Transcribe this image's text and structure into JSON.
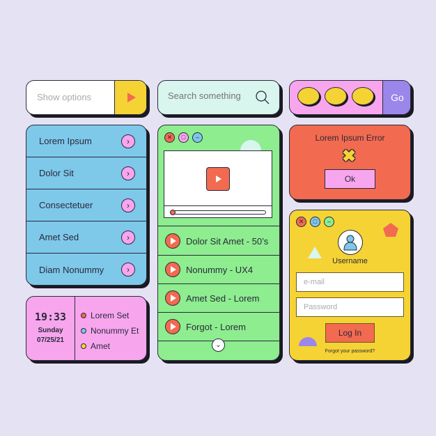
{
  "options_bar": {
    "label": "Show options",
    "button_icon": "play-icon"
  },
  "search": {
    "placeholder": "Search something",
    "icon": "search-icon"
  },
  "bubbles": {
    "go_label": "Go",
    "icon": "speech-bubble-icon"
  },
  "list": {
    "items": [
      {
        "label": "Lorem Ipsum"
      },
      {
        "label": "Dolor Sit"
      },
      {
        "label": "Consectetuer"
      },
      {
        "label": "Amet Sed"
      },
      {
        "label": "Diam Nonummy"
      }
    ]
  },
  "clock": {
    "time": "19:33",
    "day": "Sunday",
    "date": "07/25/21",
    "events": [
      {
        "label": "Lorem Set",
        "color": "#f26a50"
      },
      {
        "label": "Nonummy Et",
        "color": "#7ec8ea"
      },
      {
        "label": "Amet",
        "color": "#f5d335"
      }
    ]
  },
  "player": {
    "playlist": [
      {
        "label": "Dolor Sit Amet - 50’s"
      },
      {
        "label": "Nonummy - UX4"
      },
      {
        "label": "Amet Sed - Lorem"
      },
      {
        "label": "Forgot - Lorem"
      }
    ],
    "progress": 0.05
  },
  "error": {
    "title": "Lorem Ipsum Error",
    "ok_label": "Ok"
  },
  "login": {
    "username": "Username",
    "email_placeholder": "e-mail",
    "password_placeholder": "Password",
    "login_label": "Log In",
    "forgot": "Forgot your password?"
  },
  "colors": {
    "background": "#e5e3f3",
    "blue": "#7ec8ea",
    "green": "#8ded8f",
    "pink": "#f7a6ee",
    "yellow": "#f5d335",
    "red": "#f26a50",
    "purple": "#9b86ea"
  }
}
